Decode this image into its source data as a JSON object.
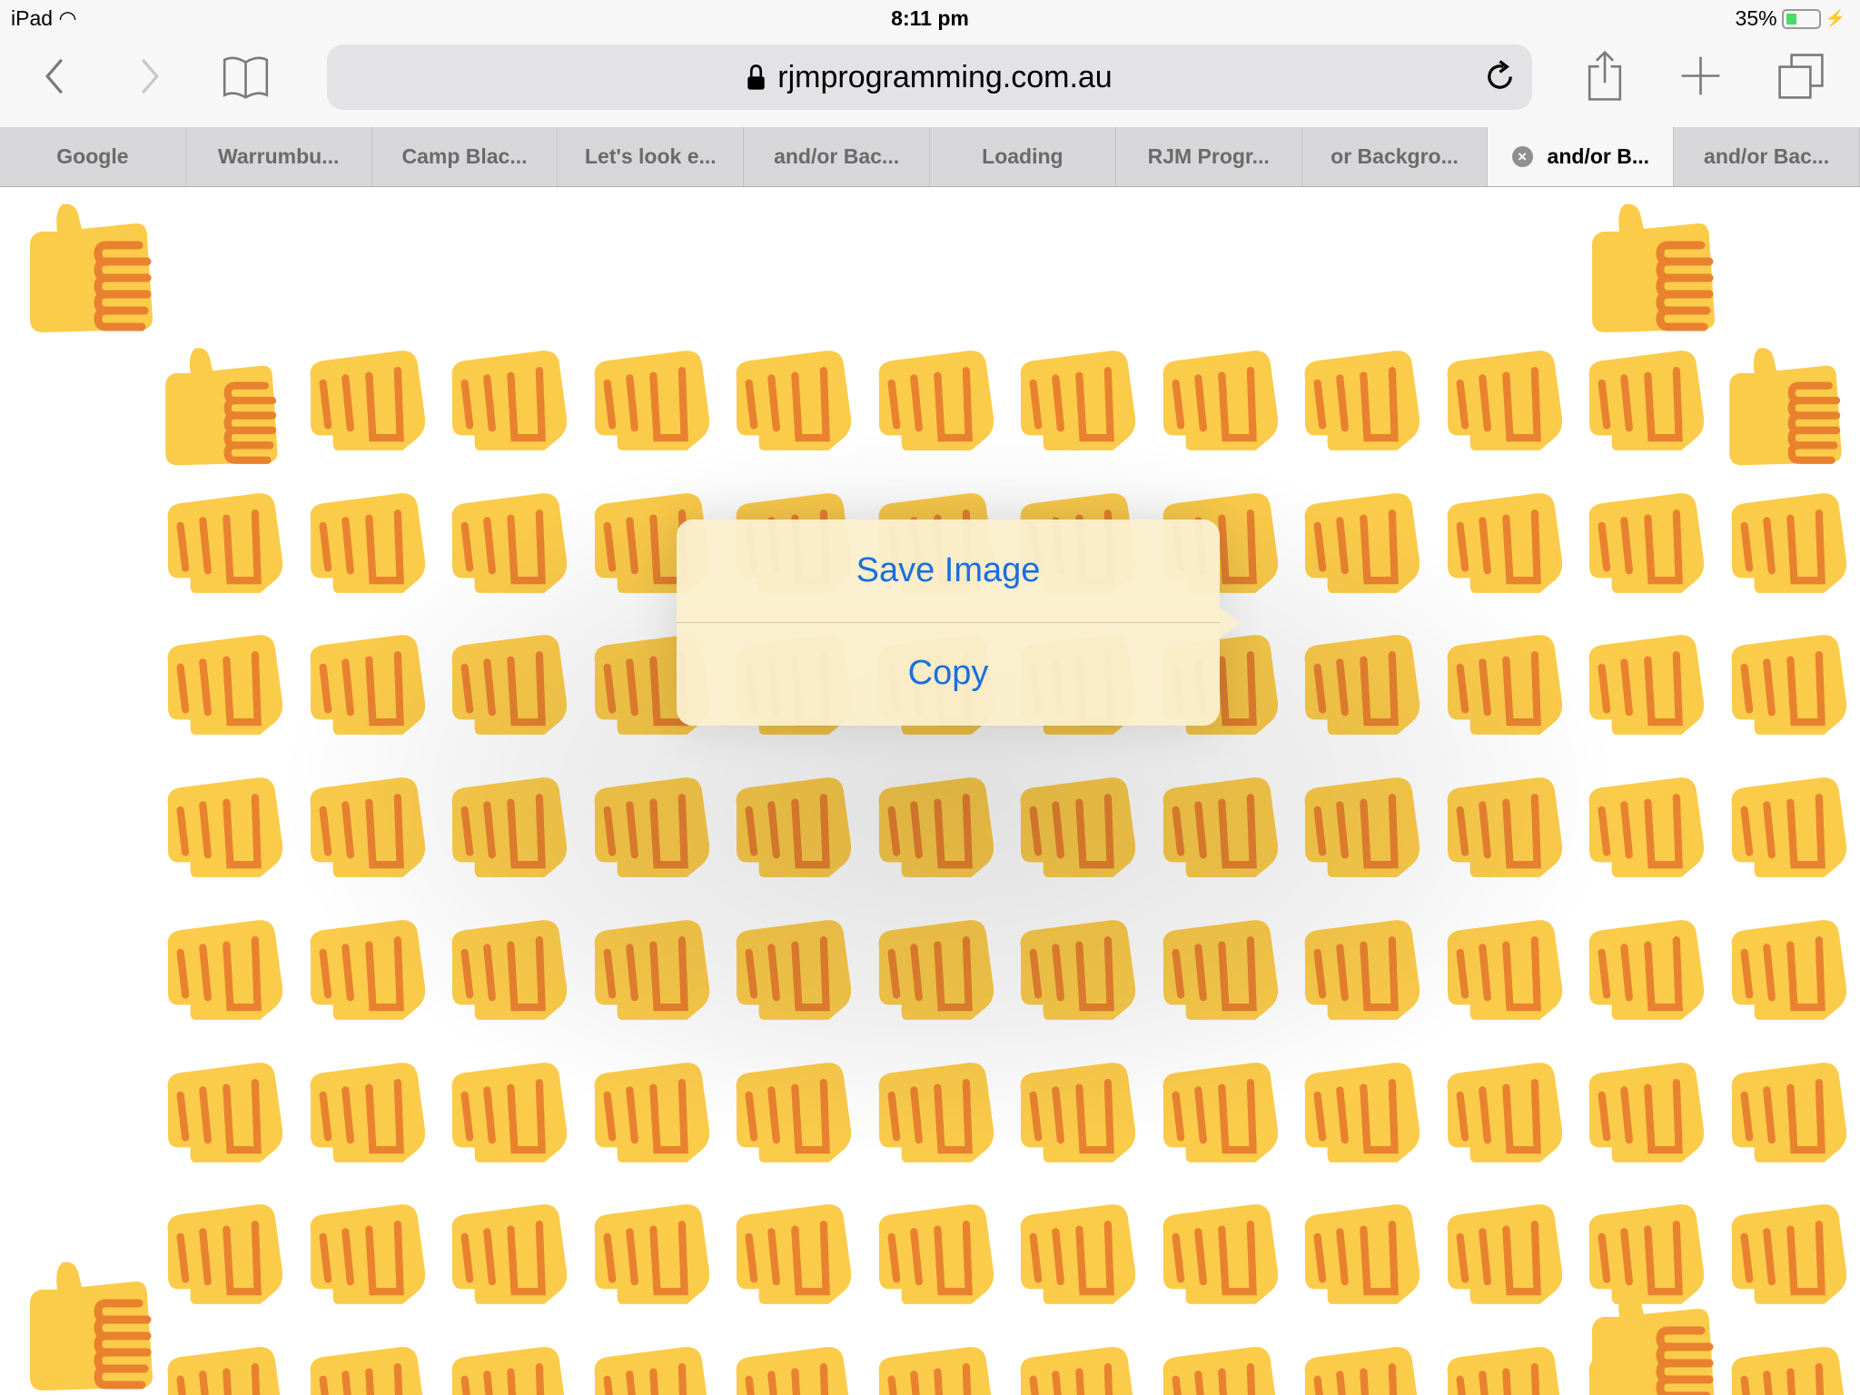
{
  "status_bar": {
    "device": "iPad",
    "time": "8:11 pm",
    "battery": "35%",
    "battery_level": 0.35,
    "wifi_icon": "wifi-icon",
    "charging_icon": "bolt-icon"
  },
  "toolbar": {
    "url": "rjmprogramming.com.au",
    "icons": [
      "back-icon",
      "forward-icon",
      "bookmarks-icon",
      "lock-icon",
      "reload-icon",
      "share-icon",
      "new-tab-icon",
      "tabs-icon"
    ]
  },
  "tabs": [
    {
      "label": "Google"
    },
    {
      "label": "Warrumbu..."
    },
    {
      "label": "Camp Blac..."
    },
    {
      "label": "Let's look e..."
    },
    {
      "label": "and/or Bac..."
    },
    {
      "label": "Loading"
    },
    {
      "label": "RJM Progr..."
    },
    {
      "label": "or Backgro..."
    },
    {
      "label": "and/or B...",
      "active": true
    },
    {
      "label": "and/or Bac..."
    }
  ],
  "context_menu": {
    "save_image": "Save Image",
    "copy": "Copy",
    "text_color": "#1a6fe0"
  },
  "page": {
    "emoji": [
      "thumbs-up-icon",
      "oncoming-fist-icon"
    ],
    "colors": {
      "yellow": "#fbcb4a",
      "orange": "#e8822f"
    }
  }
}
